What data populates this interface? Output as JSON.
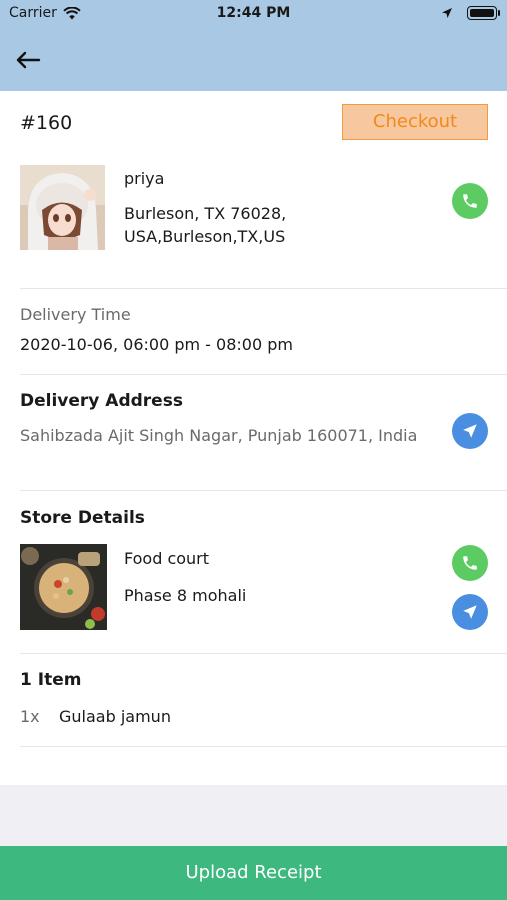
{
  "status_bar": {
    "carrier": "Carrier",
    "time": "12:44 PM"
  },
  "order": {
    "id": "#160",
    "checkout_label": "Checkout"
  },
  "customer": {
    "name": "priya",
    "address": "Burleson, TX 76028, USA,Burleson,TX,US"
  },
  "delivery_time": {
    "label": "Delivery Time",
    "value": "2020-10-06, 06:00 pm - 08:00 pm"
  },
  "delivery_address": {
    "heading": "Delivery Address",
    "value": "Sahibzada Ajit Singh Nagar, Punjab 160071, India"
  },
  "store": {
    "heading": "Store Details",
    "name": "Food court",
    "address": "Phase 8 mohali"
  },
  "items": {
    "heading": "1 Item",
    "list": [
      {
        "qty": "1x",
        "name": "Gulaab jamun"
      }
    ]
  },
  "footer": {
    "upload_label": "Upload Receipt"
  },
  "colors": {
    "header_bg": "#a8c8e4",
    "checkout_bg": "#f7c8a0",
    "checkout_text": "#f08a1a",
    "call_green": "#5ccb61",
    "navigate_blue": "#4a8ee2",
    "upload_green": "#3db87e"
  }
}
